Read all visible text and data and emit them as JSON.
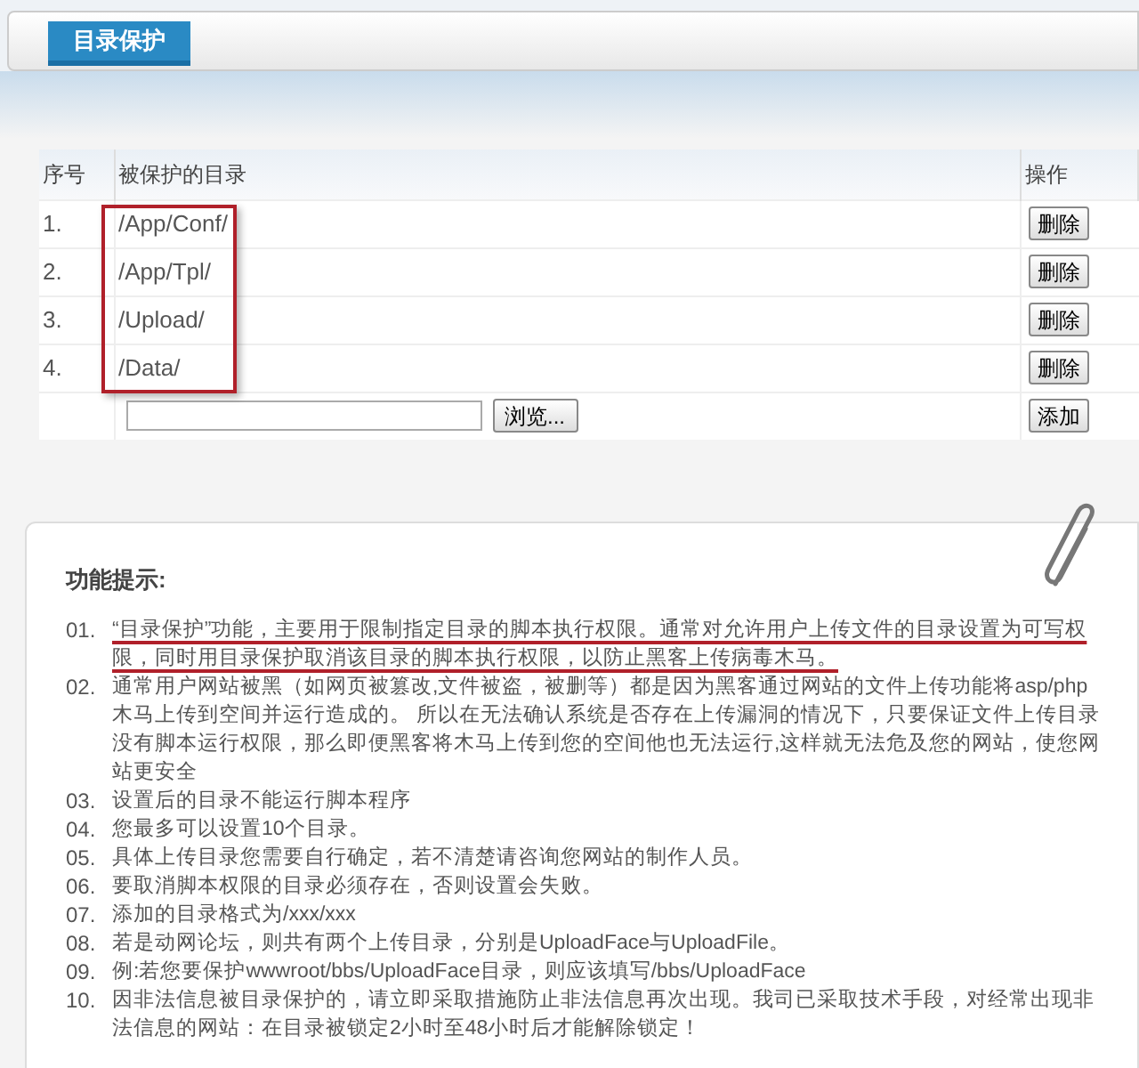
{
  "tab": {
    "label": "目录保护",
    "selected": true
  },
  "table": {
    "columns": [
      "序号",
      "被保护的目录",
      "操作"
    ],
    "framed": true,
    "rows": [
      {
        "no": "1.",
        "path": "/App/Conf/",
        "action": "删除"
      },
      {
        "no": "2.",
        "path": "/App/Tpl/",
        "action": "删除"
      },
      {
        "no": "3.",
        "path": "/Upload/",
        "action": "删除"
      },
      {
        "no": "4.",
        "path": "/Data/",
        "action": "删除"
      }
    ],
    "add_row": {
      "browse": "浏览...",
      "action": "添加"
    }
  },
  "tips": {
    "title": "功能提示:",
    "items": [
      {
        "no": "01.",
        "text": "“目录保护”功能，主要用于限制指定目录的脚本执行权限。通常对允许用户上传文件的目录设置为可写权限，同时用目录保护取消该目录的脚本执行权限，以防止黑客上传病毒木马。",
        "underlined": true
      },
      {
        "no": "02.",
        "text": "通常用户网站被黑（如网页被篡改,文件被盗，被删等）都是因为黑客通过网站的文件上传功能将asp/php木马上传到空间并运行造成的。 所以在无法确认系统是否存在上传漏洞的情况下，只要保证文件上传目录没有脚本运行权限，那么即便黑客将木马上传到您的空间他也无法运行,这样就无法危及您的网站，使您网站更安全",
        "underlined": false
      },
      {
        "no": "03.",
        "text": "设置后的目录不能运行脚本程序",
        "underlined": false
      },
      {
        "no": "04.",
        "text": "您最多可以设置10个目录。",
        "underlined": false
      },
      {
        "no": "05.",
        "text": "具体上传目录您需要自行确定，若不清楚请咨询您网站的制作人员。",
        "underlined": false
      },
      {
        "no": "06.",
        "text": "要取消脚本权限的目录必须存在，否则设置会失败。",
        "underlined": false
      },
      {
        "no": "07.",
        "text": "添加的目录格式为/xxx/xxx",
        "underlined": false
      },
      {
        "no": "08.",
        "text": "若是动网论坛，则共有两个上传目录，分别是UploadFace与UploadFile。",
        "underlined": false
      },
      {
        "no": "09.",
        "text": "例:若您要保护wwwroot/bbs/UploadFace目录，则应该填写/bbs/UploadFace",
        "underlined": false
      },
      {
        "no": "10.",
        "text": "因非法信息被目录保护的，请立即采取措施防止非法信息再次出现。我司已采取技术手段，对经常出现非法信息的网站：在目录被锁定2小时至48小时后才能解除锁定！",
        "underlined": false
      }
    ]
  }
}
